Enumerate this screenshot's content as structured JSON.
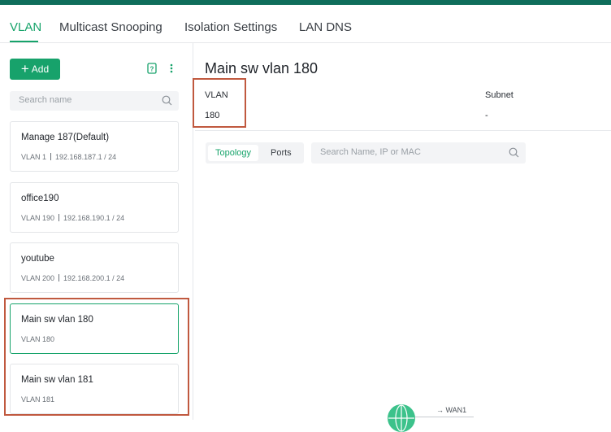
{
  "tabs": [
    {
      "label": "VLAN",
      "active": true
    },
    {
      "label": "Multicast Snooping",
      "active": false
    },
    {
      "label": "Isolation Settings",
      "active": false
    },
    {
      "label": "LAN DNS",
      "active": false
    }
  ],
  "sidebar": {
    "add_label": "Add",
    "search_placeholder": "Search name",
    "vlans": [
      {
        "name": "Manage 187(Default)",
        "vlan": "VLAN 1",
        "subnet": "192.168.187.1 / 24"
      },
      {
        "name": "office190",
        "vlan": "VLAN 190",
        "subnet": "192.168.190.1 / 24"
      },
      {
        "name": "youtube",
        "vlan": "VLAN 200",
        "subnet": "192.168.200.1 / 24"
      },
      {
        "name": "Main sw vlan 180",
        "vlan": "VLAN 180",
        "subnet": ""
      },
      {
        "name": "Main sw vlan 181",
        "vlan": "VLAN 181",
        "subnet": ""
      }
    ]
  },
  "main": {
    "title": "Main sw vlan 180",
    "vlan_label": "VLAN",
    "vlan_value": "180",
    "subnet_label": "Subnet",
    "subnet_value": "-",
    "views": [
      "Topology",
      "Ports"
    ],
    "search_placeholder": "Search Name, IP or MAC",
    "topology": {
      "wan_label": "→ WAN1"
    }
  },
  "colors": {
    "accent": "#16a36a",
    "topbar": "#0f6e5b",
    "highlight": "#c0593f"
  }
}
